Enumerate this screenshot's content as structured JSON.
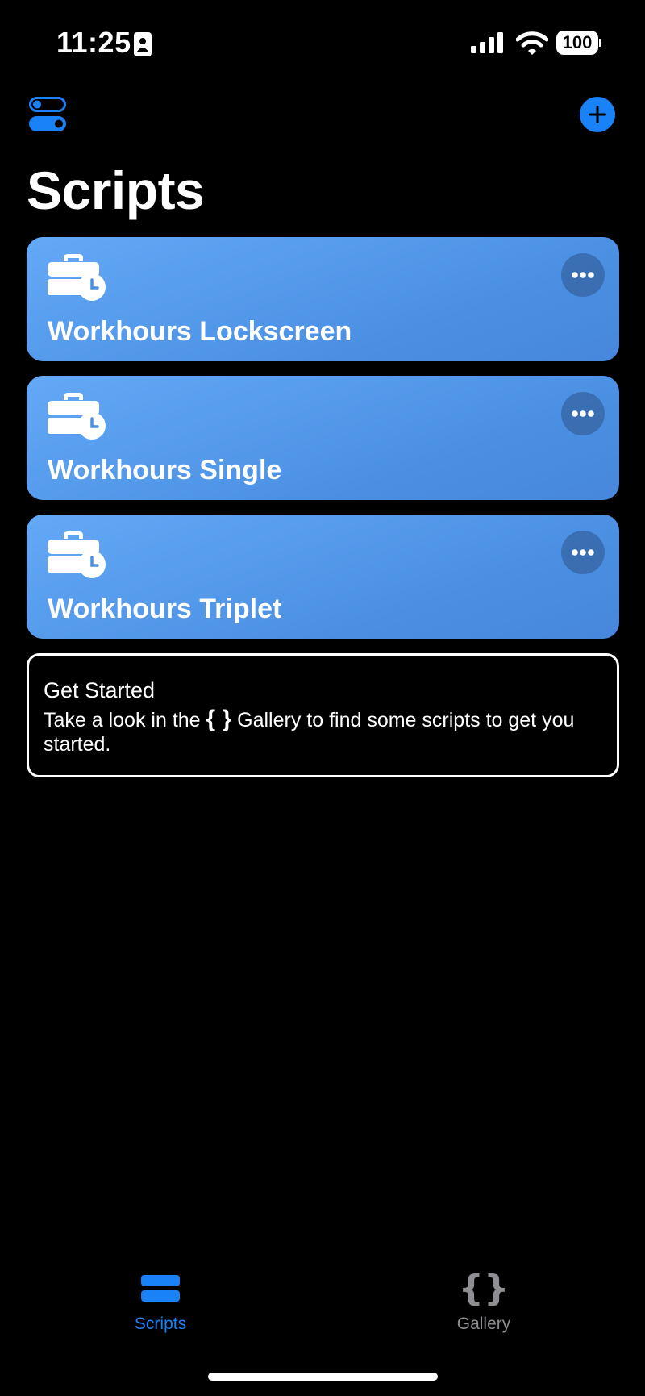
{
  "status_bar": {
    "time": "11:25",
    "battery": "100"
  },
  "nav": {
    "title": "Scripts"
  },
  "scripts": [
    {
      "title": "Workhours Lockscreen",
      "icon": "briefcase-clock-icon"
    },
    {
      "title": "Workhours Single",
      "icon": "briefcase-clock-icon"
    },
    {
      "title": "Workhours Triplet",
      "icon": "briefcase-clock-icon"
    }
  ],
  "get_started": {
    "title": "Get Started",
    "text_before": "Take a look in the ",
    "braces": "{ }",
    "text_after": " Gallery to find some scripts to get you started."
  },
  "tab_bar": {
    "tabs": [
      {
        "label": "Scripts",
        "icon": "stack-icon",
        "active": true
      },
      {
        "label": "Gallery",
        "icon": "braces-icon",
        "active": false
      }
    ],
    "gallery_icon_glyph": "{}"
  },
  "colors": {
    "accent": "#1a82f7",
    "card_gradient_start": "#63a9f7",
    "card_gradient_end": "#4787dc",
    "inactive_tab": "#8e8e93"
  }
}
